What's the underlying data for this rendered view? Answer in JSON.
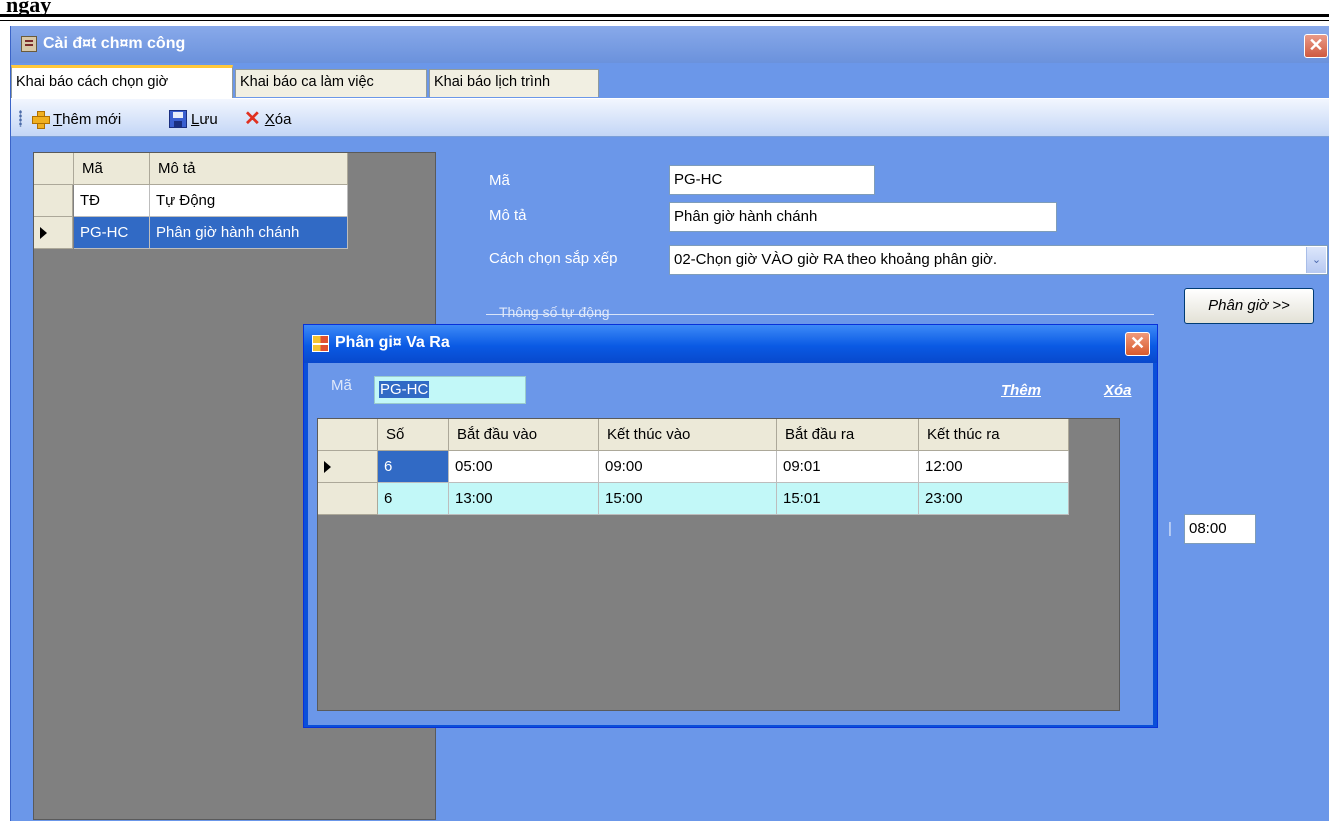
{
  "document_header": {
    "cut_text": "ngày"
  },
  "window": {
    "title": "Cài đ¤t ch¤m công",
    "close_glyph": "✕"
  },
  "tabs": [
    {
      "label": "Khai báo cách chọn giờ"
    },
    {
      "label": "Khai báo ca làm việc"
    },
    {
      "label": "Khai báo lịch trình"
    }
  ],
  "toolbar": {
    "add_prefix": "T",
    "add_rest": "hêm mới",
    "save_prefix": "L",
    "save_rest": "ưu",
    "delete_prefix": "X",
    "delete_rest": "óa"
  },
  "list_grid": {
    "columns": [
      "Mã",
      "Mô tả"
    ],
    "rows": [
      {
        "code": "TĐ",
        "desc": "Tự Động"
      },
      {
        "code": "PG-HC",
        "desc": "Phân giờ hành chánh"
      }
    ]
  },
  "form": {
    "code_label": "Mã",
    "code_value": "PG-HC",
    "desc_label": "Mô tả",
    "desc_value": "Phân giờ hành chánh",
    "sort_label": "Cách chọn sắp xếp",
    "sort_value": "02-Chọn giờ VÀO giờ RA theo khoảng phân giờ.",
    "group_title": "Thông số tự động",
    "split_button": "Phân giờ >>",
    "time_value": "08:00",
    "combo_arrow": "⌄"
  },
  "dialog": {
    "title": "Phân gi¤ Va Ra",
    "close_glyph": "✕",
    "code_label": "Mã",
    "code_value": "PG-HC",
    "add_link": "Thêm",
    "delete_link": "Xóa",
    "columns": [
      "Số",
      "Bắt đầu vào",
      "Kết thúc vào",
      "Bắt đầu ra",
      "Kết thúc ra"
    ],
    "rows": [
      {
        "so": "6",
        "bdv": "05:00",
        "ktv": "09:00",
        "bdr": "09:01",
        "ktr": "12:00"
      },
      {
        "so": "6",
        "bdv": "13:00",
        "ktv": "15:00",
        "bdr": "15:01",
        "ktr": "23:00"
      }
    ]
  },
  "colors": {
    "window_bg": "#6b97e9",
    "dialog_frame": "#0a4fd9",
    "grid_bg": "#808080",
    "selection": "#316ac5",
    "alt_row": "#c2f8f8"
  }
}
